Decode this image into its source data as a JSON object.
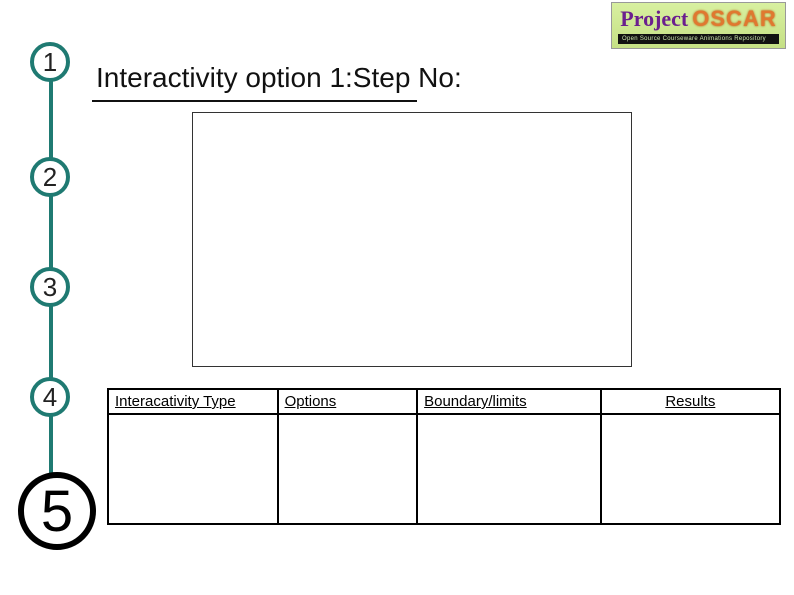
{
  "logo": {
    "project": "Project",
    "oscar": "OSCAR",
    "subtitle": "Open Source Courseware Animations Repository"
  },
  "title": "Interactivity option 1:Step No:",
  "steps": {
    "s1": "1",
    "s2": "2",
    "s3": "3",
    "s4": "4",
    "s5": "5"
  },
  "table": {
    "headers": {
      "type": "Interacativity Type",
      "options": "Options",
      "boundary": "Boundary/limits",
      "results": "Results"
    },
    "rows": [
      {
        "type": "",
        "options": "",
        "boundary": "",
        "results": ""
      }
    ]
  }
}
